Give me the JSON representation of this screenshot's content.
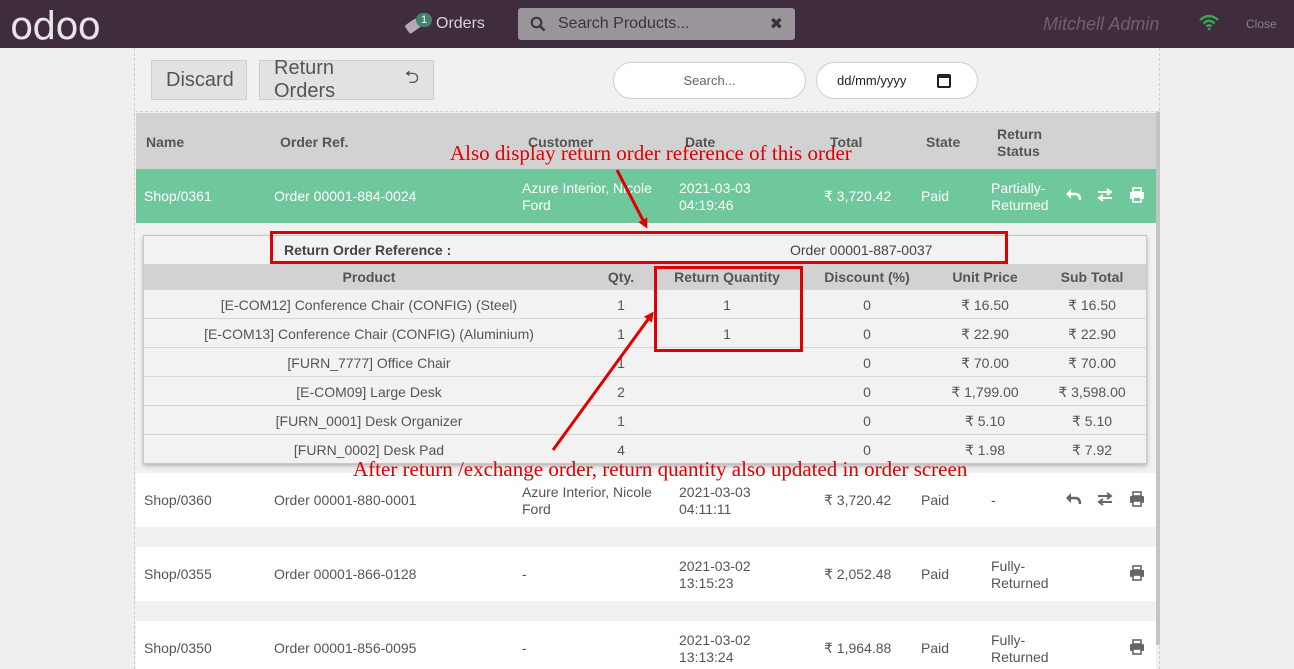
{
  "topbar": {
    "logo": "odoo",
    "orders_label": "Orders",
    "orders_badge": "1",
    "search_placeholder": "Search Products...",
    "user_name": "Mitchell Admin",
    "close_label": "Close"
  },
  "controls": {
    "discard_label": "Discard",
    "return_orders_label": "Return Orders",
    "search_placeholder": "Search...",
    "date_placeholder": "dd/mm/yyyy"
  },
  "table": {
    "headers": [
      "Name",
      "Order Ref.",
      "Customer",
      "Date",
      "Total",
      "State",
      "Return Status"
    ],
    "return_status_header_l1": "Return",
    "return_status_header_l2": "Status",
    "rows": [
      {
        "name": "Shop/0361",
        "ref": "Order 00001-884-0024",
        "cust1": "Azure Interior, Nicole",
        "cust2": "Ford",
        "date1": "2021-03-03",
        "date2": "04:19:46",
        "total": "₹ 3,720.42",
        "state": "Paid",
        "rs1": "Partially-",
        "rs2": "Returned"
      },
      {
        "name": "Shop/0360",
        "ref": "Order 00001-880-0001",
        "cust1": "Azure Interior, Nicole",
        "cust2": "Ford",
        "date1": "2021-03-03",
        "date2": "04:11:11",
        "total": "₹ 3,720.42",
        "state": "Paid",
        "rs1": "-",
        "rs2": ""
      },
      {
        "name": "Shop/0355",
        "ref": "Order 00001-866-0128",
        "cust1": "-",
        "cust2": "",
        "date1": "2021-03-02",
        "date2": "13:15:23",
        "total": "₹ 2,052.48",
        "state": "Paid",
        "rs1": "Fully-",
        "rs2": "Returned"
      },
      {
        "name": "Shop/0350",
        "ref": "Order 00001-856-0095",
        "cust1": "-",
        "cust2": "",
        "date1": "2021-03-02",
        "date2": "13:13:24",
        "total": "₹ 1,964.88",
        "state": "Paid",
        "rs1": "Fully-",
        "rs2": "Returned"
      }
    ]
  },
  "detail": {
    "ref_label": "Return Order Reference :",
    "ref_value": "Order 00001-887-0037",
    "headers": [
      "Product",
      "Qty.",
      "Return Quantity",
      "Discount (%)",
      "Unit Price",
      "Sub Total"
    ],
    "lines": [
      {
        "product": "[E-COM12] Conference Chair (CONFIG) (Steel)",
        "qty": "1",
        "ret": "1",
        "disc": "0",
        "price": "₹ 16.50",
        "sub": "₹ 16.50"
      },
      {
        "product": "[E-COM13] Conference Chair (CONFIG) (Aluminium)",
        "qty": "1",
        "ret": "1",
        "disc": "0",
        "price": "₹ 22.90",
        "sub": "₹ 22.90"
      },
      {
        "product": "[FURN_7777] Office Chair",
        "qty": "1",
        "ret": "",
        "disc": "0",
        "price": "₹ 70.00",
        "sub": "₹ 70.00"
      },
      {
        "product": "[E-COM09] Large Desk",
        "qty": "2",
        "ret": "",
        "disc": "0",
        "price": "₹ 1,799.00",
        "sub": "₹ 3,598.00"
      },
      {
        "product": "[FURN_0001] Desk Organizer",
        "qty": "1",
        "ret": "",
        "disc": "0",
        "price": "₹ 5.10",
        "sub": "₹ 5.10"
      },
      {
        "product": "[FURN_0002] Desk Pad",
        "qty": "4",
        "ret": "",
        "disc": "0",
        "price": "₹ 1.98",
        "sub": "₹ 7.92"
      }
    ]
  },
  "annotations": {
    "top": "Also display return order reference of this order",
    "bottom": "After return /exchange order, return quantity also updated in order screen"
  },
  "colors": {
    "topbar": "#3f2d3e",
    "selected_row": "#6ec89b",
    "annotation": "#e00000",
    "badge": "#42826e"
  }
}
